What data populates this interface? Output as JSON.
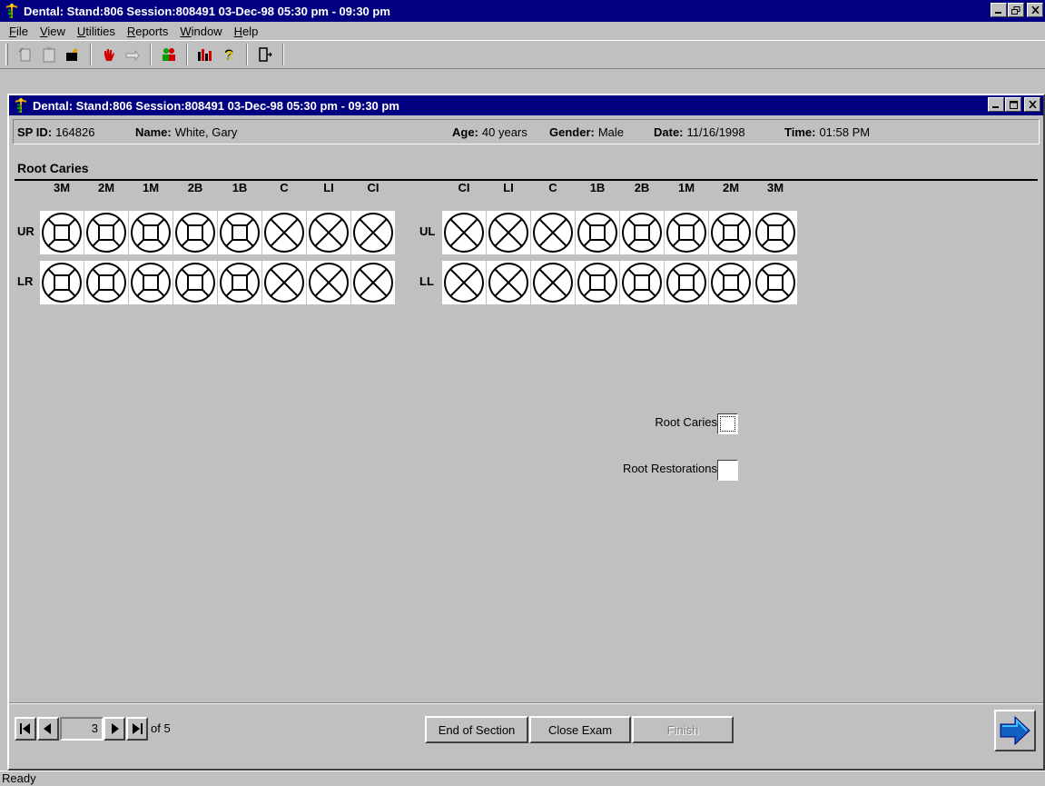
{
  "app": {
    "title": "Dental: Stand:806 Session:808491 03-Dec-98 05:30 pm - 09:30 pm",
    "icon": "caduceus-icon"
  },
  "menu": [
    "File",
    "View",
    "Utilities",
    "Reports",
    "Window",
    "Help"
  ],
  "toolbar": {
    "groups": [
      [
        "new-icon",
        "clipboard-icon",
        "open-folder-icon"
      ],
      [
        "stop-hand-icon",
        "pointer-hand-icon"
      ],
      [
        "people-icon"
      ],
      [
        "chart-icon",
        "help-question-icon"
      ],
      [
        "exit-door-icon"
      ]
    ]
  },
  "child": {
    "title": "Dental: Stand:806 Session:808491 03-Dec-98 05:30 pm - 09:30 pm"
  },
  "info": {
    "sp_id_label": "SP ID:",
    "sp_id": "164826",
    "name_label": "Name:",
    "name": "White, Gary",
    "age_label": "Age:",
    "age": "40 years",
    "gender_label": "Gender:",
    "gender": "Male",
    "date_label": "Date:",
    "date": "11/16/1998",
    "time_label": "Time:",
    "time": "01:58 PM"
  },
  "section": {
    "title": "Root Caries",
    "right_headers": [
      "3M",
      "2M",
      "1M",
      "2B",
      "1B",
      "C",
      "LI",
      "CI"
    ],
    "left_headers": [
      "CI",
      "LI",
      "C",
      "1B",
      "2B",
      "1M",
      "2M",
      "3M"
    ],
    "rows": [
      {
        "right_label": "UR",
        "left_label": "UL"
      },
      {
        "right_label": "LR",
        "left_label": "LL"
      }
    ],
    "right_tooth_types": [
      "molar",
      "molar",
      "molar",
      "molar",
      "molar",
      "anterior",
      "anterior",
      "anterior"
    ],
    "left_tooth_types": [
      "anterior",
      "anterior",
      "anterior",
      "molar",
      "molar",
      "molar",
      "molar",
      "molar"
    ]
  },
  "options": {
    "root_caries_label": "Root Caries",
    "root_restorations_label": "Root Restorations"
  },
  "nav": {
    "page": "3",
    "of_text": "of 5"
  },
  "buttons": {
    "end_of_section": "End of Section",
    "close_exam": "Close Exam",
    "finish": "Finish"
  },
  "status": "Ready"
}
